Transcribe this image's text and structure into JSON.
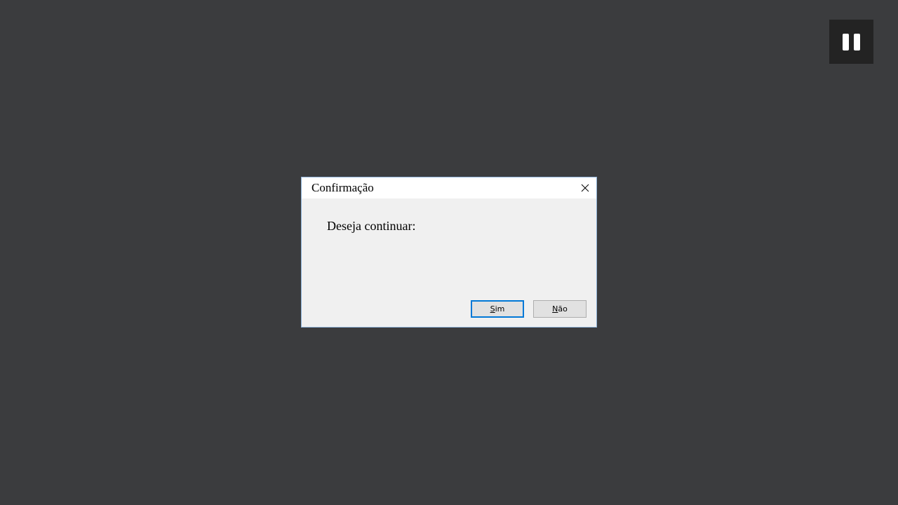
{
  "dialog": {
    "title": "Confirmação",
    "message": "Deseja continuar:",
    "buttons": {
      "yes": {
        "mnemonic": "S",
        "rest": "im"
      },
      "no": {
        "mnemonic": "N",
        "rest": "ão"
      }
    },
    "close_icon": "close-icon",
    "accent_color": "#0078d7"
  },
  "overlay": {
    "pause_icon": "pause-icon"
  }
}
